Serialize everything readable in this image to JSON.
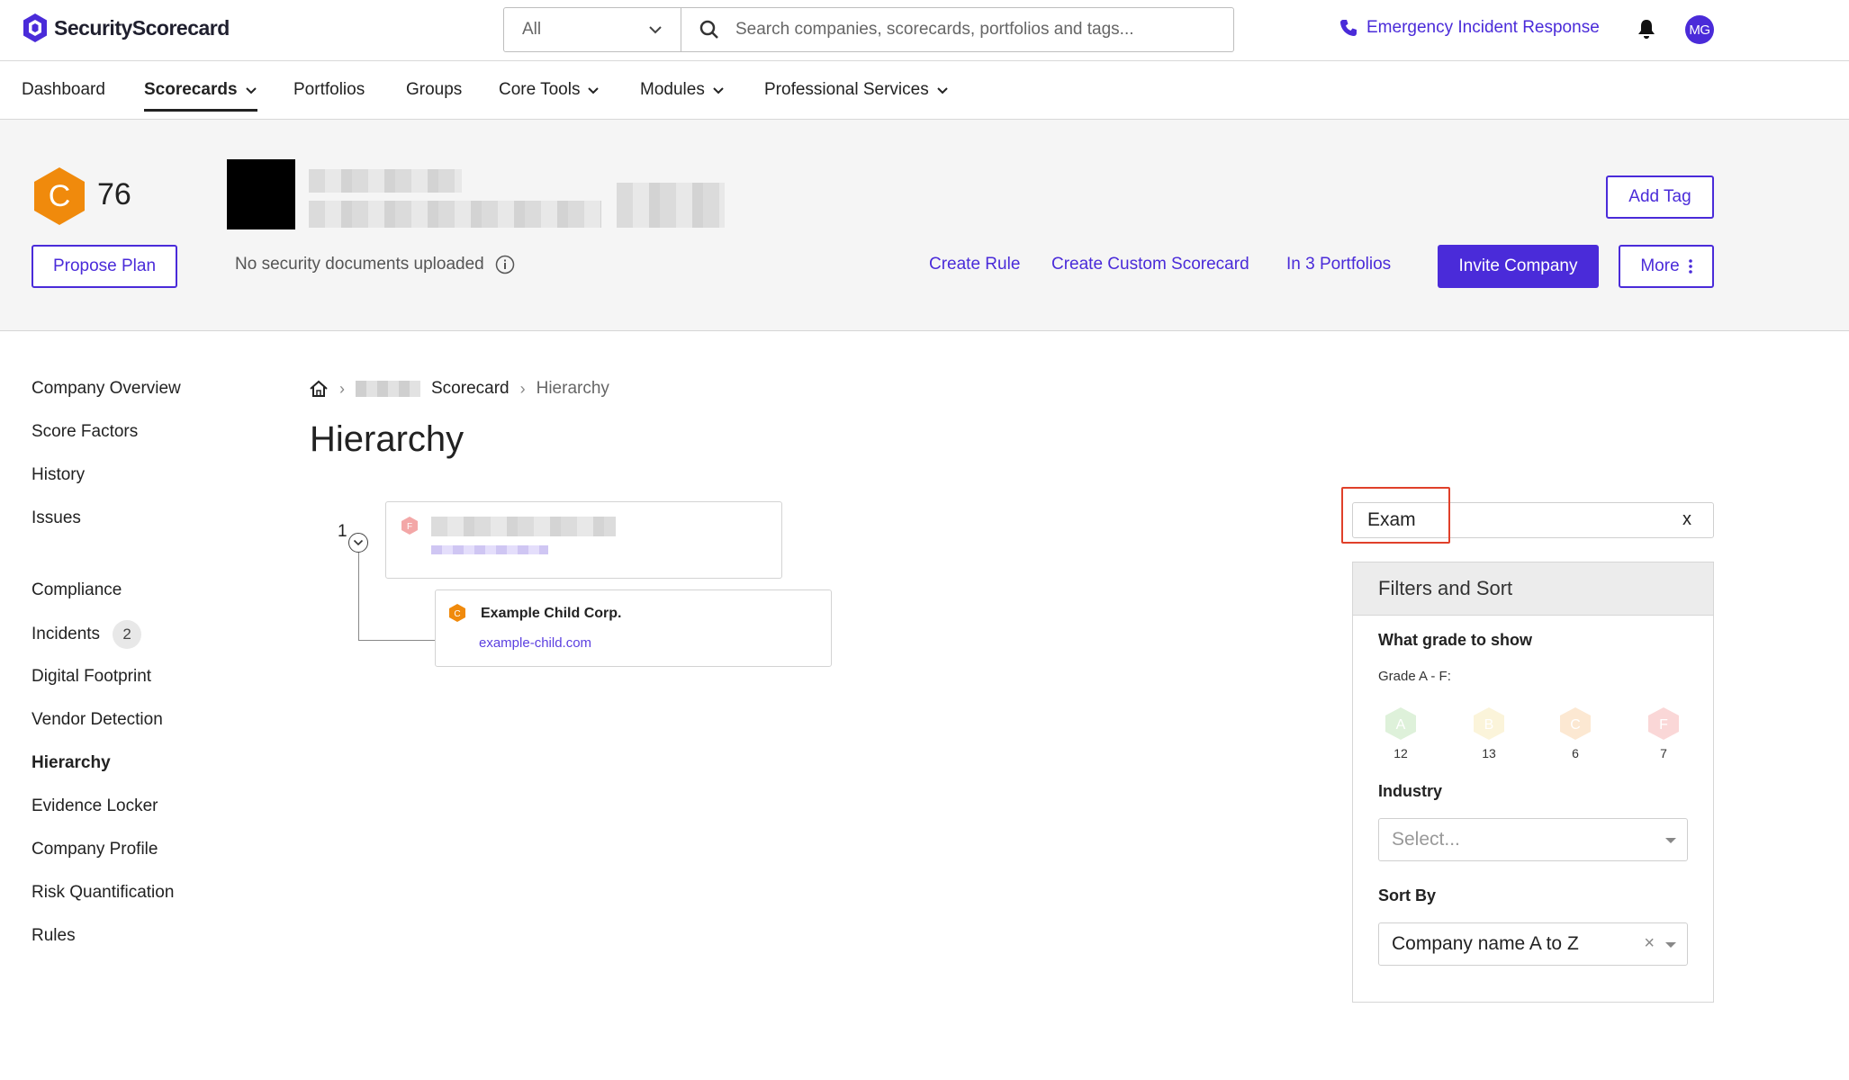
{
  "brand": {
    "name": "SecurityScorecard",
    "accent": "#4a2bd9"
  },
  "topbar": {
    "search_scope": "All",
    "search_placeholder": "Search companies, scorecards, portfolios and tags...",
    "emergency_label": "Emergency Incident Response",
    "avatar_initials": "MG"
  },
  "nav": {
    "items": [
      {
        "label": "Dashboard"
      },
      {
        "label": "Scorecards"
      },
      {
        "label": "Portfolios"
      },
      {
        "label": "Groups"
      },
      {
        "label": "Core Tools"
      },
      {
        "label": "Modules"
      },
      {
        "label": "Professional Services"
      }
    ]
  },
  "header": {
    "grade": "C",
    "grade_color": "#f08a0c",
    "score": "76",
    "propose_plan": "Propose Plan",
    "no_docs": "No security documents uploaded",
    "add_tag": "Add Tag",
    "create_rule": "Create Rule",
    "create_custom_scorecard": "Create Custom Scorecard",
    "in_portfolios": "In 3 Portfolios",
    "invite_company": "Invite Company",
    "more": "More"
  },
  "sidebar": {
    "items": [
      {
        "label": "Company Overview"
      },
      {
        "label": "Score Factors"
      },
      {
        "label": "History"
      },
      {
        "label": "Issues"
      },
      {
        "label": "Compliance"
      },
      {
        "label": "Incidents",
        "badge": "2"
      },
      {
        "label": "Digital Footprint"
      },
      {
        "label": "Vendor Detection"
      },
      {
        "label": "Hierarchy"
      },
      {
        "label": "Evidence Locker"
      },
      {
        "label": "Company Profile"
      },
      {
        "label": "Risk Quantification"
      },
      {
        "label": "Rules"
      }
    ]
  },
  "breadcrumb": {
    "scorecard": "Scorecard",
    "current": "Hierarchy"
  },
  "page_title": "Hierarchy",
  "tree": {
    "index": "1",
    "parent": {
      "grade": "F"
    },
    "child": {
      "grade": "C",
      "name": "Example Child Corp.",
      "domain": "example-child.com"
    }
  },
  "filter": {
    "value": "Exam",
    "clear": "x",
    "panel_title": "Filters and Sort",
    "grade_heading": "What grade to show",
    "grade_sub": "Grade A - F:",
    "grades": [
      {
        "letter": "A",
        "count": "12",
        "color": "#7cc76a"
      },
      {
        "letter": "B",
        "count": "13",
        "color": "#efd36a"
      },
      {
        "letter": "C",
        "count": "6",
        "color": "#f4a24a"
      },
      {
        "letter": "F",
        "count": "7",
        "color": "#ec5f5f"
      }
    ],
    "industry_label": "Industry",
    "industry_placeholder": "Select...",
    "sort_label": "Sort By",
    "sort_value": "Company name A to Z",
    "sort_clear": "×"
  }
}
